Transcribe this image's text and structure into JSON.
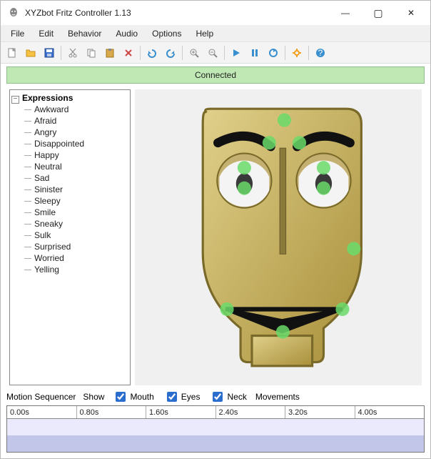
{
  "window": {
    "title": "XYZbot Fritz Controller 1.13",
    "minimize_label": "—",
    "maximize_label": "▢",
    "close_label": "✕"
  },
  "menubar": {
    "file": "File",
    "edit": "Edit",
    "behavior": "Behavior",
    "audio": "Audio",
    "options": "Options",
    "help": "Help"
  },
  "status": {
    "connection": "Connected"
  },
  "tree": {
    "root_label": "Expressions",
    "toggle_glyph": "−",
    "items": {
      "0": "Awkward",
      "1": "Afraid",
      "2": "Angry",
      "3": "Disappointed",
      "4": "Happy",
      "5": "Neutral",
      "6": "Sad",
      "7": "Sinister",
      "8": "Sleepy",
      "9": "Smile",
      "10": "Sneaky",
      "11": "Sulk",
      "12": "Surprised",
      "13": "Worried",
      "14": "Yelling"
    }
  },
  "sequencer": {
    "title": "Motion Sequencer",
    "show_label": "Show",
    "mouth_label": "Mouth",
    "eyes_label": "Eyes",
    "neck_label": "Neck",
    "movements_label": "Movements",
    "mouth_checked": true,
    "eyes_checked": true,
    "neck_checked": true,
    "ticks": {
      "0": "0.00s",
      "1": "0.80s",
      "2": "1.60s",
      "3": "2.40s",
      "4": "3.20s",
      "5": "4.00s"
    }
  }
}
